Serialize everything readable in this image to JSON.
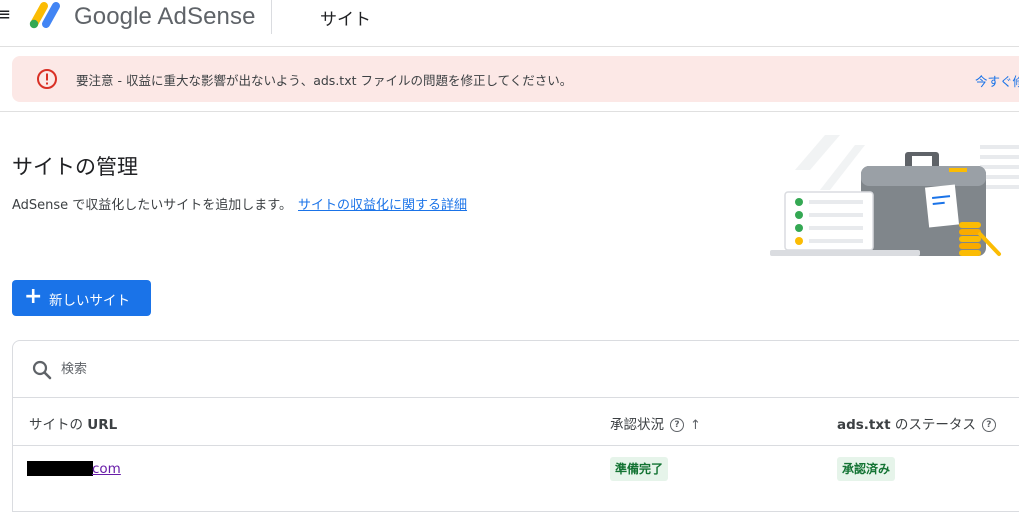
{
  "header": {
    "brand": "Google AdSense",
    "breadcrumb": "サイト",
    "menu_glyph": "≡"
  },
  "banner": {
    "message": "要注意 - 収益に重大な影響が出ないよう、ads.txt ファイルの問題を修正してください。",
    "action_label": "今すぐ修"
  },
  "page": {
    "title": "サイトの管理",
    "description": "AdSense で収益化したいサイトを追加します。",
    "learn_more_link": "サイトの収益化に関する詳細",
    "new_site_button": "新しいサイト"
  },
  "table": {
    "search_placeholder": "検索",
    "columns": {
      "url_prefix": "サイトの ",
      "url_bold": "URL",
      "approval_status": "承認状況",
      "ads_txt_prefix": "ads.txt",
      "ads_txt_suffix": " のステータス"
    },
    "rows": [
      {
        "site_url_visible": "com",
        "approval_status": "準備完了",
        "ads_txt_status": "承認済み"
      }
    ]
  },
  "colors": {
    "accent": "#1a73e8",
    "banner_bg": "#fce8e6",
    "error": "#d93025",
    "status_bg": "#e6f4ea",
    "status_text": "#137333",
    "visited_link": "#681da8"
  }
}
